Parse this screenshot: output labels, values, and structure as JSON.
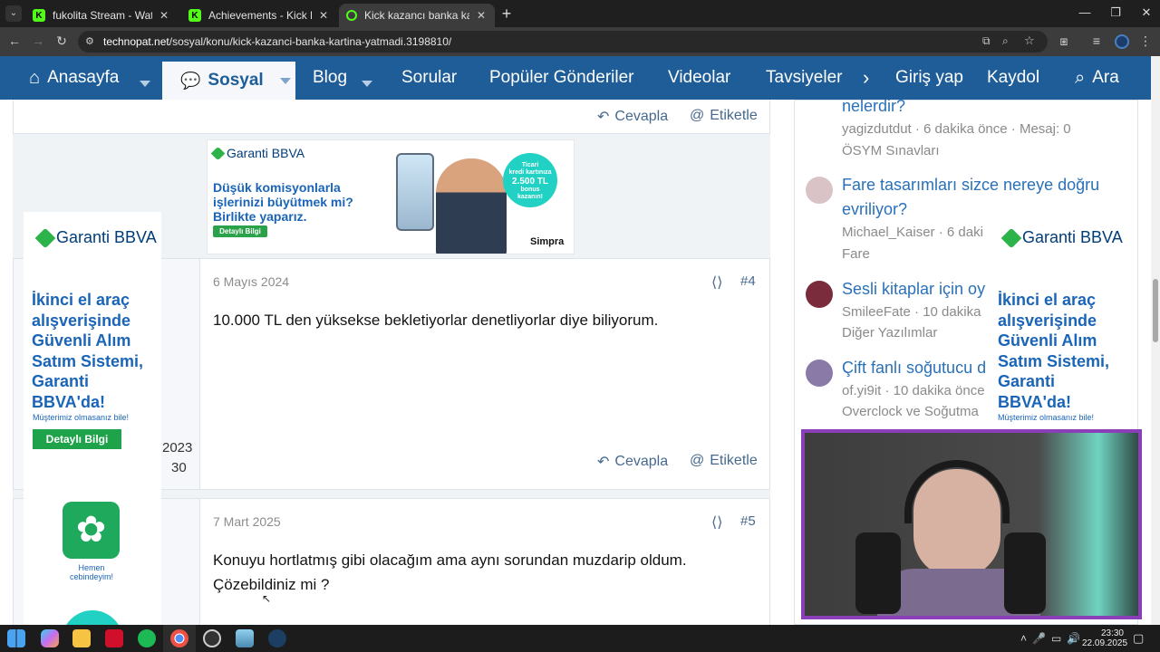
{
  "browser": {
    "tabs": [
      {
        "title": "fukolita Stream - Watch Live on",
        "favicon": "kick-icon"
      },
      {
        "title": "Achievements - Kick Dashboard",
        "favicon": "kick-icon"
      },
      {
        "title": "Kick kazancı banka kartına yatm",
        "favicon": "loading-icon"
      }
    ],
    "new_tab": "+",
    "url_host": "technopat.net",
    "url_path": "/sosyal/konu/kick-kazanci-banka-kartina-yatmadi.3198810/"
  },
  "nav": {
    "items": [
      "Anasayfa",
      "Sosyal",
      "Blog",
      "Sorular",
      "Popüler Gönderiler",
      "Videolar",
      "Tavsiyeler"
    ],
    "login": "Giriş yap",
    "register": "Kaydol",
    "search": "Ara"
  },
  "post_actions": {
    "reply": "Cevapla",
    "tag": "Etiketle"
  },
  "posts": [
    {
      "date": "6 Mayıs 2024",
      "number": "#4",
      "text": "10.000 TL den yüksekse bekletiyorlar denetliyorlar diye biliyorum.",
      "user_year": "2023",
      "user_count": "30"
    },
    {
      "date": "7 Mart 2025",
      "number": "#5",
      "text_line1": "Konuyu hortlatmış gibi olacağım ama aynı sorundan muzdarip oldum.",
      "text_line2": "Çözebildiniz mi ?"
    }
  ],
  "banner_ad": {
    "brand": "Garanti BBVA",
    "headline1": "Düşük komisyonlarla",
    "headline2": "işlerinizi büyütmek mi?",
    "headline3": "Birlikte yaparız.",
    "cta": "Detaylı Bilgi",
    "badge1": "Ticari",
    "badge2": "kredi kartınıza",
    "badge3": "2.500 TL",
    "badge4": "bonus",
    "badge5": "kazanın!",
    "partner": "Simpra"
  },
  "left_ad": {
    "brand": "Garanti BBVA",
    "line1": "İkinci el araç",
    "line2": "alışverişinde",
    "line3": "Güvenli Alım",
    "line4": "Satım Sistemi,",
    "line5": "Garanti",
    "line6": "BBVA'da!",
    "small": "Müşterimiz olmasanız bile!",
    "cta": "Detaylı Bilgi",
    "app1": "Hemen",
    "app2": "cebindeyim!"
  },
  "right_ad": {
    "brand": "Garanti BBVA",
    "line1": "İkinci el araç",
    "line2": "alışverişinde",
    "line3": "Güvenli Alım",
    "line4": "Satım Sistemi,",
    "line5": "Garanti",
    "line6": "BBVA'da!",
    "small": "Müşterimiz olmasanız bile!"
  },
  "sidebar": {
    "items": [
      {
        "title": "nelerdir?",
        "meta1": "yagizdutdut · 6 dakika önce · Mesaj: 0",
        "meta2": "ÖSYM Sınavları"
      },
      {
        "title1": "Fare tasarımları sizce nereye doğru",
        "title2": "evriliyor?",
        "meta1": "Michael_Kaiser · 6 daki",
        "meta2": "Fare"
      },
      {
        "title": "Sesli kitaplar için oy",
        "meta1": "SmileeFate · 10 dakika",
        "meta2": "Diğer Yazılımlar"
      },
      {
        "title": "Çift fanlı soğutucu d",
        "meta1": "of.yi9it · 10 dakika önce",
        "meta2": "Overclock ve Soğutma"
      }
    ]
  },
  "taskbar": {
    "time": "23:30",
    "date": "22.09.2025"
  }
}
